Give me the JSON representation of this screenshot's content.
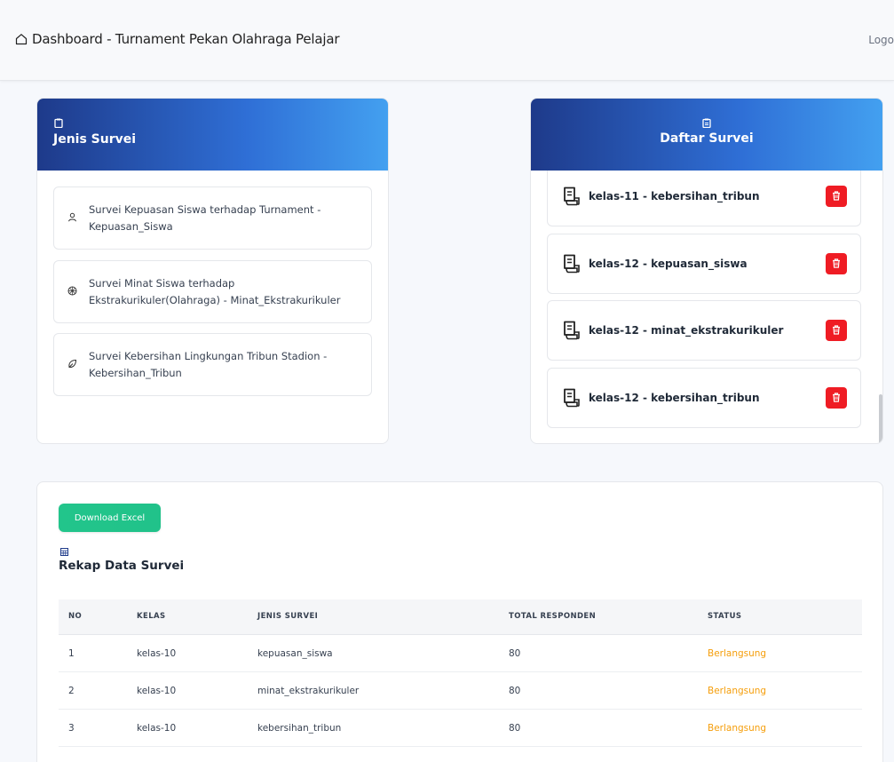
{
  "header": {
    "title": "Dashboard - Turnament Pekan Olahraga Pelajar",
    "logout": "Logo"
  },
  "jenis_survei": {
    "title": "Jenis Survei",
    "items": [
      {
        "icon": "user-icon",
        "label": "Survei Kepuasan Siswa terhadap Turnament - Kepuasan_Siswa"
      },
      {
        "icon": "ball-icon",
        "label": "Survei Minat Siswa terhadap Ekstrakurikuler(Olahraga) - Minat_Ekstrakurikuler"
      },
      {
        "icon": "leaf-icon",
        "label": "Survei Kebersihan Lingkungan Tribun Stadion - Kebersihan_Tribun"
      }
    ]
  },
  "daftar_survei": {
    "title": "Daftar Survei",
    "items": [
      {
        "label": "kelas-11 - kebersihan_tribun"
      },
      {
        "label": "kelas-12 - kepuasan_siswa"
      },
      {
        "label": "kelas-12 - minat_ekstrakurikuler"
      },
      {
        "label": "kelas-12 - kebersihan_tribun"
      }
    ]
  },
  "rekap": {
    "download_label": "Download Excel",
    "title": "Rekap Data Survei",
    "columns": [
      "NO",
      "KELAS",
      "JENIS SURVEI",
      "TOTAL RESPONDEN",
      "STATUS"
    ],
    "rows": [
      {
        "no": "1",
        "kelas": "kelas-10",
        "jenis": "kepuasan_siswa",
        "total": "80",
        "status": "Berlangsung"
      },
      {
        "no": "2",
        "kelas": "kelas-10",
        "jenis": "minat_ekstrakurikuler",
        "total": "80",
        "status": "Berlangsung"
      },
      {
        "no": "3",
        "kelas": "kelas-10",
        "jenis": "kebersihan_tribun",
        "total": "80",
        "status": "Berlangsung"
      }
    ]
  },
  "colors": {
    "header_gradient_start": "#1e3a8a",
    "header_gradient_end": "#43a0f0",
    "delete_red": "#ef1c24",
    "download_green": "#22c58b",
    "status_orange": "#f59e0b"
  }
}
